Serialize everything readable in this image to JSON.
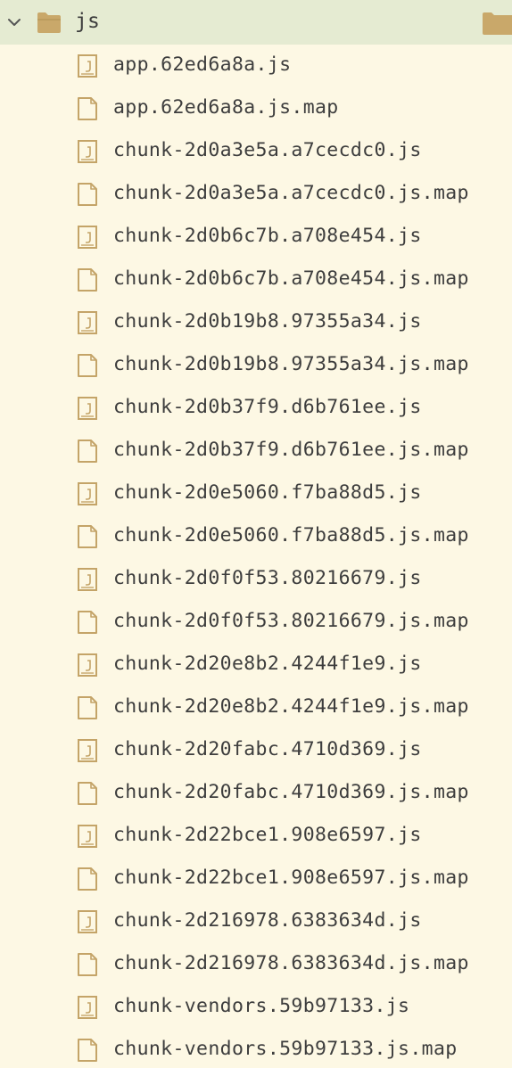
{
  "folder": {
    "name": "js",
    "expanded": true,
    "icon": "folder-icon",
    "colors": {
      "folder_fill": "#c9a86a",
      "row_highlight": "#e5ebd2",
      "background": "#fdf8e4",
      "icon_stroke": "#c4a468"
    }
  },
  "files": [
    {
      "name": "app.62ed6a8a.js",
      "type": "js"
    },
    {
      "name": "app.62ed6a8a.js.map",
      "type": "map"
    },
    {
      "name": "chunk-2d0a3e5a.a7cecdc0.js",
      "type": "js"
    },
    {
      "name": "chunk-2d0a3e5a.a7cecdc0.js.map",
      "type": "map"
    },
    {
      "name": "chunk-2d0b6c7b.a708e454.js",
      "type": "js"
    },
    {
      "name": "chunk-2d0b6c7b.a708e454.js.map",
      "type": "map"
    },
    {
      "name": "chunk-2d0b19b8.97355a34.js",
      "type": "js"
    },
    {
      "name": "chunk-2d0b19b8.97355a34.js.map",
      "type": "map"
    },
    {
      "name": "chunk-2d0b37f9.d6b761ee.js",
      "type": "js"
    },
    {
      "name": "chunk-2d0b37f9.d6b761ee.js.map",
      "type": "map"
    },
    {
      "name": "chunk-2d0e5060.f7ba88d5.js",
      "type": "js"
    },
    {
      "name": "chunk-2d0e5060.f7ba88d5.js.map",
      "type": "map"
    },
    {
      "name": "chunk-2d0f0f53.80216679.js",
      "type": "js"
    },
    {
      "name": "chunk-2d0f0f53.80216679.js.map",
      "type": "map"
    },
    {
      "name": "chunk-2d20e8b2.4244f1e9.js",
      "type": "js"
    },
    {
      "name": "chunk-2d20e8b2.4244f1e9.js.map",
      "type": "map"
    },
    {
      "name": "chunk-2d20fabc.4710d369.js",
      "type": "js"
    },
    {
      "name": "chunk-2d20fabc.4710d369.js.map",
      "type": "map"
    },
    {
      "name": "chunk-2d22bce1.908e6597.js",
      "type": "js"
    },
    {
      "name": "chunk-2d22bce1.908e6597.js.map",
      "type": "map"
    },
    {
      "name": "chunk-2d216978.6383634d.js",
      "type": "js"
    },
    {
      "name": "chunk-2d216978.6383634d.js.map",
      "type": "map"
    },
    {
      "name": "chunk-vendors.59b97133.js",
      "type": "js"
    },
    {
      "name": "chunk-vendors.59b97133.js.map",
      "type": "map"
    }
  ]
}
